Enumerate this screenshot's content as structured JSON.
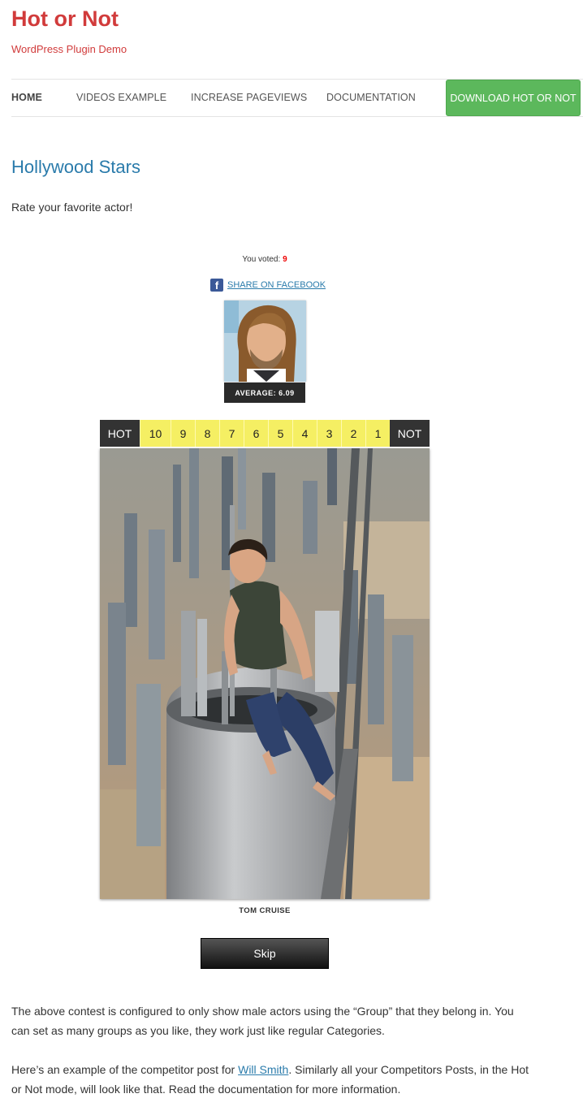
{
  "site": {
    "title": "Hot or Not",
    "description": "WordPress Plugin Demo"
  },
  "nav": {
    "items": [
      {
        "label": "HOME",
        "active": true
      },
      {
        "label": "VIDEOS EXAMPLE"
      },
      {
        "label": "INCREASE PAGEVIEWS"
      },
      {
        "label": "DOCUMENTATION"
      }
    ],
    "download_label": "DOWNLOAD HOT OR NOT",
    "download_color": "#5cb85c"
  },
  "page": {
    "title": "Hollywood Stars",
    "intro": "Rate your favorite actor!"
  },
  "last_vote": {
    "prefix": "You voted:",
    "value": "9",
    "share_label": "SHARE ON FACEBOOK",
    "share_icon": "facebook-icon",
    "average_label": "AVERAGE: 6.09"
  },
  "rating": {
    "hot_label": "HOT",
    "not_label": "NOT",
    "scores": [
      "10",
      "9",
      "8",
      "7",
      "6",
      "5",
      "4",
      "3",
      "2",
      "1"
    ]
  },
  "current": {
    "caption": "TOM CRUISE",
    "skip_label": "Skip"
  },
  "content": {
    "p1": "The above contest is configured to only show male actors using the “Group” that they belong in. You can set as many groups as you like, they work just like regular Categories.",
    "p2_before": "Here’s an example of the competitor post for ",
    "p2_link": "Will Smith",
    "p2_after": ". Similarly all your Competitors Posts, in the Hot or Not mode, will look like that. Read the documentation for more information."
  },
  "colors": {
    "brand_red": "#d13b3b",
    "link_blue": "#2a7bab",
    "score_yellow": "#f5ef63"
  }
}
